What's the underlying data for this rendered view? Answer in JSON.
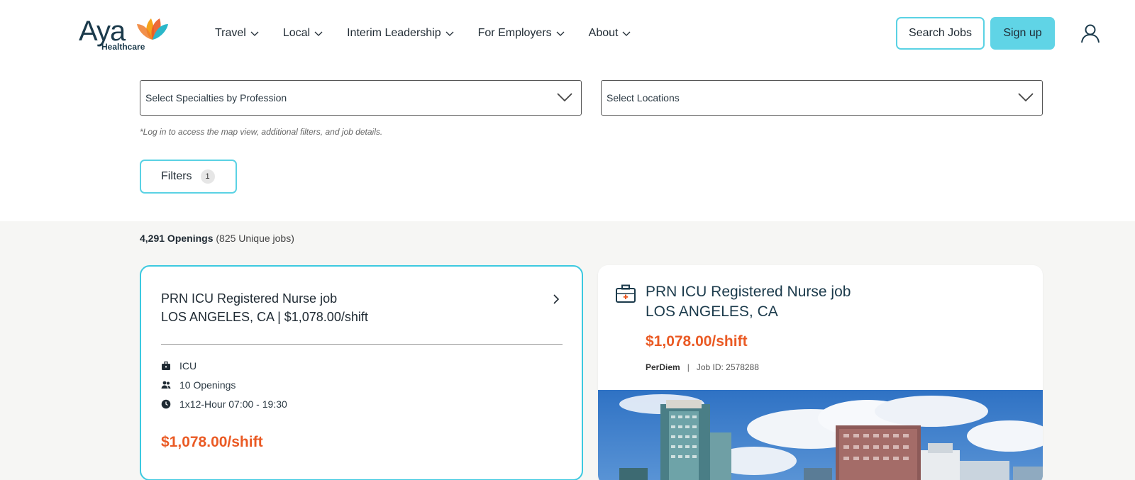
{
  "header": {
    "logo_text": "Aya",
    "logo_sub": "Healthcare",
    "nav": [
      {
        "label": "Travel"
      },
      {
        "label": "Local"
      },
      {
        "label": "Interim Leadership"
      },
      {
        "label": "For Employers"
      },
      {
        "label": "About"
      }
    ],
    "search_jobs_label": "Search Jobs",
    "signup_label": "Sign up",
    "icons": {
      "user": "user-icon",
      "chevron": "chevron-down-icon"
    }
  },
  "filters": {
    "specialties_placeholder": "Select Specialties by Profession",
    "locations_placeholder": "Select Locations",
    "login_note": "*Log in to access the map view, additional filters, and job details.",
    "filters_label": "Filters",
    "filters_count": "1"
  },
  "results": {
    "openings_count": "4,291 Openings",
    "unique_jobs": "(825 Unique jobs)"
  },
  "job_card": {
    "title_line1": "PRN ICU Registered Nurse job",
    "title_line2": "LOS ANGELES, CA | $1,078.00/shift",
    "specialty": "ICU",
    "openings": "10 Openings",
    "schedule": "1x12-Hour 07:00 - 19:30",
    "price": "$1,078.00/shift"
  },
  "job_detail": {
    "title_line1": "PRN ICU Registered Nurse job",
    "title_line2": "LOS ANGELES, CA",
    "price": "$1,078.00/shift",
    "job_type": "PerDiem",
    "separator": "|",
    "job_id": "Job ID: 2578288"
  },
  "colors": {
    "accent": "#5ad2e4",
    "price": "#ea5a24",
    "brand_dark": "#1b3a4b",
    "results_bg": "#f6f6f4"
  }
}
